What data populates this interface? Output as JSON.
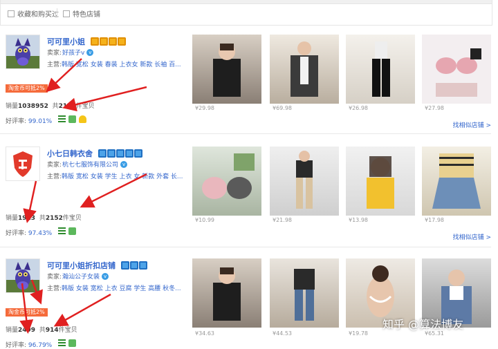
{
  "filters": [
    {
      "label": "收藏和购买过"
    },
    {
      "label": "特色店铺"
    }
  ],
  "shops": [
    {
      "name": "可可里小姐",
      "crowns": {
        "count": 4,
        "color": "gold"
      },
      "seller_label": "卖家:",
      "seller": "好孩子v",
      "category_label": "主营:",
      "categories": "韩版 宽松 女装 春装 上衣女 新款 长袖 百...",
      "tag": "淘金币可抵2%",
      "sales_label": "销量",
      "sales": "1038952",
      "items_prefix": "共",
      "items": "2122",
      "items_suffix": "件宝贝",
      "rate_label": "好评率:",
      "rate": "99.01%",
      "icons": [
        "green-stripe-icon",
        "green-box-icon",
        "yellow-badge-icon"
      ],
      "prices": [
        "¥29.98",
        "¥69.98",
        "¥26.98",
        "¥27.98"
      ],
      "similar": "找相似店铺 >",
      "logo": "cat-avatar-icon"
    },
    {
      "name": "小七日韩衣舍",
      "crowns": {
        "count": 5,
        "color": "blue"
      },
      "seller_label": "卖家:",
      "seller": "杭七七服饰有限公司",
      "category_label": "主营:",
      "categories": "韩版 宽松 女装 学生 上衣 女 新款 外套 长...",
      "tag": "",
      "sales_label": "销量",
      "sales": "1913",
      "items_prefix": "共",
      "items": "2152",
      "items_suffix": "件宝贝",
      "rate_label": "好评率:",
      "rate": "97.43%",
      "icons": [
        "green-stripe-icon",
        "green-box-icon"
      ],
      "prices": [
        "¥10.99",
        "¥21.98",
        "¥13.98",
        "¥17.98"
      ],
      "similar": "找相似店铺 >",
      "logo": "red-shield-logo-icon"
    },
    {
      "name": "可可里小姐折扣店铺",
      "crowns": {
        "count": 3,
        "color": "blue"
      },
      "seller_label": "卖家:",
      "seller": "瀚汕公子女装",
      "category_label": "主营:",
      "categories": "韩版 女装 宽松 上衣 豆腐 学生 高腰 秋冬...",
      "tag": "淘金币可抵2%",
      "sales_label": "销量",
      "sales": "2499",
      "items_prefix": "共",
      "items": "914",
      "items_suffix": "件宝贝",
      "rate_label": "好评率:",
      "rate": "96.79%",
      "icons": [
        "green-stripe-icon",
        "green-box-icon"
      ],
      "prices": [
        "¥34.63",
        "¥44.53",
        "¥19.78",
        "¥65.31"
      ],
      "similar": "",
      "logo": "cat-avatar-icon"
    }
  ],
  "watermark": "知乎 @算法博友",
  "colors": {
    "link": "#3366cc",
    "tag": "#f56b3b",
    "arrow": "#e02020"
  }
}
